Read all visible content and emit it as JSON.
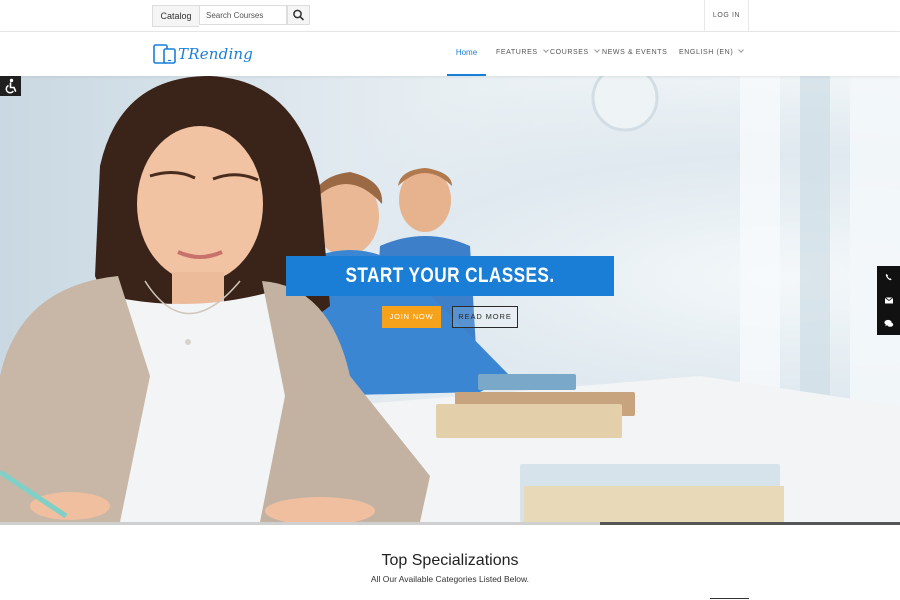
{
  "topbar": {
    "catalog_label": "Catalog",
    "search_placeholder": "Search Courses",
    "search_icon": "search-icon",
    "login_label": "LOG IN"
  },
  "navbar": {
    "logo_text": "TRending",
    "logo_icon": "devices-icon",
    "items": [
      {
        "label": "Home",
        "active": true
      },
      {
        "label": "FEATURES",
        "has_dropdown": true
      },
      {
        "label": "COURSES",
        "has_dropdown": true
      },
      {
        "label": "NEWS & EVENTS",
        "has_dropdown": false
      },
      {
        "label": "ENGLISH (EN)",
        "has_dropdown": true
      }
    ]
  },
  "hero": {
    "headline": "START YOUR CLASSES.",
    "join_label": "JOIN NOW",
    "read_more_label": "READ MORE",
    "slide_progress": 0.667
  },
  "sidebar_tools": {
    "accessibility_icon": "accessibility-icon",
    "buttons": [
      {
        "icon": "phone-icon"
      },
      {
        "icon": "envelope-icon"
      },
      {
        "icon": "chat-icon"
      }
    ]
  },
  "specializations": {
    "title": "Top Specializations",
    "subtitle": "All Our Available Categories Listed Below."
  },
  "colors": {
    "accent": "#1a7ed6",
    "join_button": "#f7a21b",
    "dark_toolbar": "#111111"
  }
}
